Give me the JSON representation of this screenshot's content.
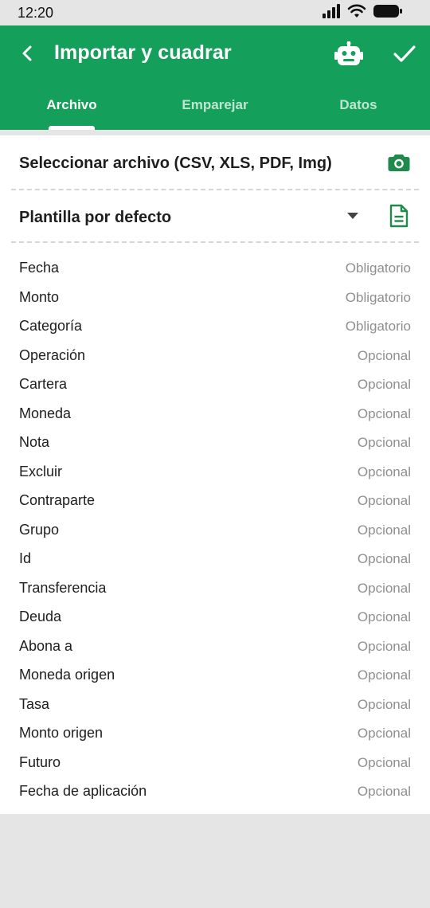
{
  "status_bar": {
    "time": "12:20",
    "icons": [
      "signal-icon",
      "wifi-icon",
      "battery-icon"
    ]
  },
  "app_bar": {
    "title": "Importar y cuadrar",
    "back_icon": "chevron-left-icon",
    "robot_icon": "robot-icon",
    "confirm_icon": "check-icon",
    "background": "#14a05a"
  },
  "tabs": [
    {
      "label": "Archivo",
      "active": true
    },
    {
      "label": "Emparejar",
      "active": false
    },
    {
      "label": "Datos",
      "active": false
    }
  ],
  "file_selector": {
    "label": "Seleccionar archivo (CSV, XLS, PDF, Img)",
    "icon": "camera-icon"
  },
  "template": {
    "label": "Plantilla por defecto",
    "dropdown_icon": "caret-down-icon",
    "doc_icon": "document-icon"
  },
  "fields": [
    {
      "name": "Fecha",
      "requirement": "Obligatorio"
    },
    {
      "name": "Monto",
      "requirement": "Obligatorio"
    },
    {
      "name": "Categoría",
      "requirement": "Obligatorio"
    },
    {
      "name": "Operación",
      "requirement": "Opcional"
    },
    {
      "name": "Cartera",
      "requirement": "Opcional"
    },
    {
      "name": "Moneda",
      "requirement": "Opcional"
    },
    {
      "name": "Nota",
      "requirement": "Opcional"
    },
    {
      "name": "Excluir",
      "requirement": "Opcional"
    },
    {
      "name": "Contraparte",
      "requirement": "Opcional"
    },
    {
      "name": "Grupo",
      "requirement": "Opcional"
    },
    {
      "name": "Id",
      "requirement": "Opcional"
    },
    {
      "name": "Transferencia",
      "requirement": "Opcional"
    },
    {
      "name": "Deuda",
      "requirement": "Opcional"
    },
    {
      "name": "Abona a",
      "requirement": "Opcional"
    },
    {
      "name": "Moneda origen",
      "requirement": "Opcional"
    },
    {
      "name": "Tasa",
      "requirement": "Opcional"
    },
    {
      "name": "Monto origen",
      "requirement": "Opcional"
    },
    {
      "name": "Futuro",
      "requirement": "Opcional"
    },
    {
      "name": "Fecha de aplicación",
      "requirement": "Opcional"
    }
  ],
  "colors": {
    "accent": "#14a05a",
    "icon_green": "#1f8a4c",
    "secondary_text": "#8f8f8f"
  }
}
